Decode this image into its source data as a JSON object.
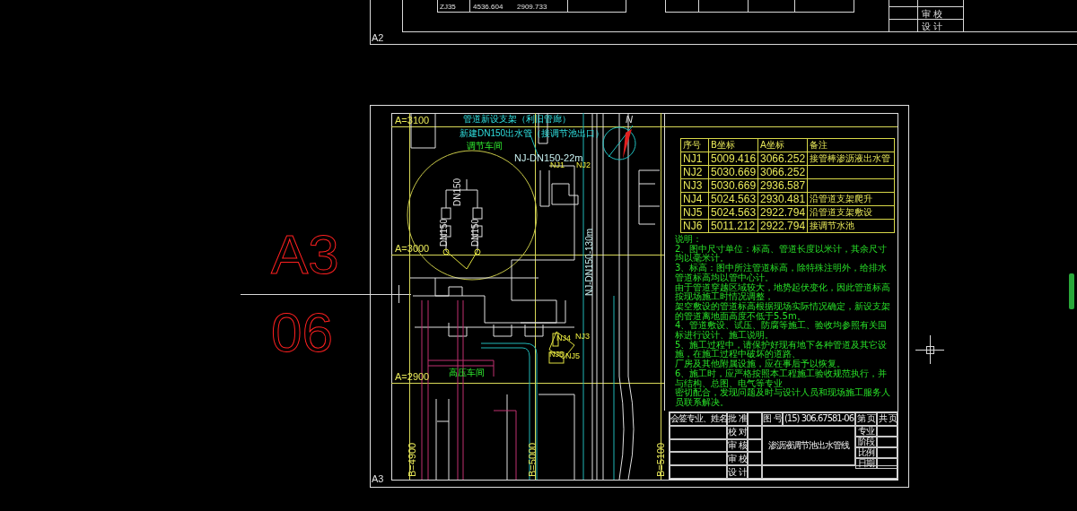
{
  "upper_sheet": {
    "sheet_label": "A2",
    "point_row": [
      "ZJ35",
      "4536.604",
      "2909.733"
    ],
    "sign_rows": [
      "审 校",
      "设 计"
    ]
  },
  "sheet_number": [
    "A3",
    "06"
  ],
  "sheet": {
    "label": "A3",
    "north": "N"
  },
  "annotations": [
    {
      "kind": "grid",
      "text": "A=3100"
    },
    {
      "kind": "note",
      "text": "管道新设支架（利旧管廊）"
    },
    {
      "kind": "note",
      "text": "新建DN150出水管（接调节池出口）"
    },
    {
      "kind": "building",
      "text": "调节车间"
    },
    {
      "kind": "pipe",
      "text": "NJ-DN150-22m"
    },
    {
      "kind": "point",
      "text": "NJ1"
    },
    {
      "kind": "point",
      "text": "NJ2"
    },
    {
      "kind": "size",
      "text": "DN150"
    },
    {
      "kind": "size",
      "text": "DN150"
    },
    {
      "kind": "size",
      "text": "DN150"
    },
    {
      "kind": "grid",
      "text": "A=3000"
    },
    {
      "kind": "pipe",
      "text": "NJ-DN150-130m"
    },
    {
      "kind": "point",
      "text": "NJ3"
    },
    {
      "kind": "point",
      "text": "NJ4"
    },
    {
      "kind": "point",
      "text": "NJ6"
    },
    {
      "kind": "point",
      "text": "NJ5"
    },
    {
      "kind": "building",
      "text": "高压车间"
    },
    {
      "kind": "grid",
      "text": "A=2900"
    },
    {
      "kind": "grid",
      "text": "B=4900"
    },
    {
      "kind": "grid",
      "text": "B=5000"
    },
    {
      "kind": "grid",
      "text": "B=5100"
    }
  ],
  "coordinate_table": {
    "columns": [
      "序号",
      "B坐标",
      "A坐标",
      "备注"
    ],
    "rows": [
      [
        "NJ1",
        "5009.416",
        "3066.252",
        "接管棒渗沥液出水管"
      ],
      [
        "NJ2",
        "5030.669",
        "3066.252",
        ""
      ],
      [
        "NJ3",
        "5030.669",
        "2936.587",
        ""
      ],
      [
        "NJ4",
        "5024.563",
        "2930.481",
        "沿管道支架爬升"
      ],
      [
        "NJ5",
        "5024.563",
        "2922.794",
        "沿管道支架敷设"
      ],
      [
        "NJ6",
        "5011.212",
        "2922.794",
        "接调节水池"
      ]
    ]
  },
  "notes": {
    "heading": "说明：",
    "items": [
      "2、图中尺寸单位：标高、管道长度以米计，其余尺寸均以毫米计。",
      "3、标高：图中所注管道标高，除特殊注明外，给排水管道标高均以管中心计。",
      "由于管道穿越区域较大，地势起伏变化，因此管道标高按现场施工时情况调整，",
      "架空敷设的管道标高根据现场实际情况确定，新设支架的管道离地面高度不低于5.5m。",
      "4、管道敷设、试压、防腐等施工、验收均参照有关国标进行设计、施工说明。",
      "5、施工过程中，请保护好现有地下各种管道及其它设施，在施工过程中破坏的道路、",
      "厂房及其他附属设施，应在事后予以恢复。",
      "6、施工时，应严格按照本工程施工验收规范执行，并与结构、总图、电气等专业",
      "密切配合，发现问题及时与设计人员和现场施工服务人员联系解决。"
    ]
  },
  "title_block": {
    "countersign": "会签专业、姓名",
    "drawing_no_label": "图 号",
    "drawing_no": "(15) 306.67581-06",
    "page": "第 页",
    "total": "共 页",
    "roles": [
      "批 准",
      "校 对",
      "审 核",
      "审 校",
      "设 计"
    ],
    "title": "渗沥液调节池出水管线",
    "fields": [
      "专业",
      "阶段",
      "比例",
      "日期"
    ]
  }
}
